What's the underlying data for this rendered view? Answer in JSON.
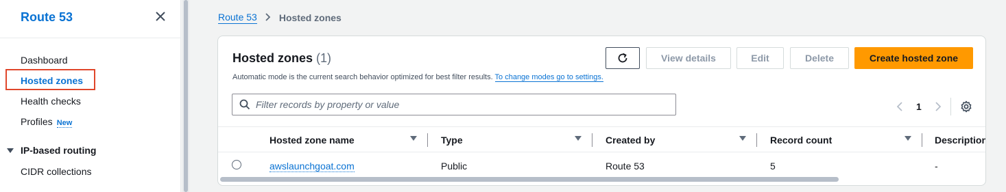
{
  "sidebar": {
    "title": "Route 53",
    "items": [
      {
        "label": "Dashboard"
      },
      {
        "label": "Hosted zones"
      },
      {
        "label": "Health checks"
      },
      {
        "label": "Profiles",
        "badge": "New"
      }
    ],
    "section": {
      "label": "IP-based routing",
      "items": [
        {
          "label": "CIDR collections"
        }
      ]
    }
  },
  "breadcrumb": {
    "root": "Route 53",
    "current": "Hosted zones"
  },
  "panel": {
    "title": "Hosted zones",
    "count": "(1)",
    "description": "Automatic mode is the current search behavior optimized for best filter results.",
    "description_link": "To change modes go to settings.",
    "buttons": {
      "view_details": "View details",
      "edit": "Edit",
      "delete": "Delete",
      "create": "Create hosted zone"
    },
    "search": {
      "placeholder": "Filter records by property or value"
    },
    "pagination": {
      "current_page": "1"
    }
  },
  "table": {
    "columns": [
      "Hosted zone name",
      "Type",
      "Created by",
      "Record count",
      "Description"
    ],
    "rows": [
      {
        "name": "awslaunchgoat.com",
        "type": "Public",
        "created_by": "Route 53",
        "record_count": "5",
        "description": "-"
      }
    ]
  },
  "colors": {
    "accent": "#0972d3",
    "primary_button": "#ff9900",
    "highlight_box": "#e0462a"
  }
}
